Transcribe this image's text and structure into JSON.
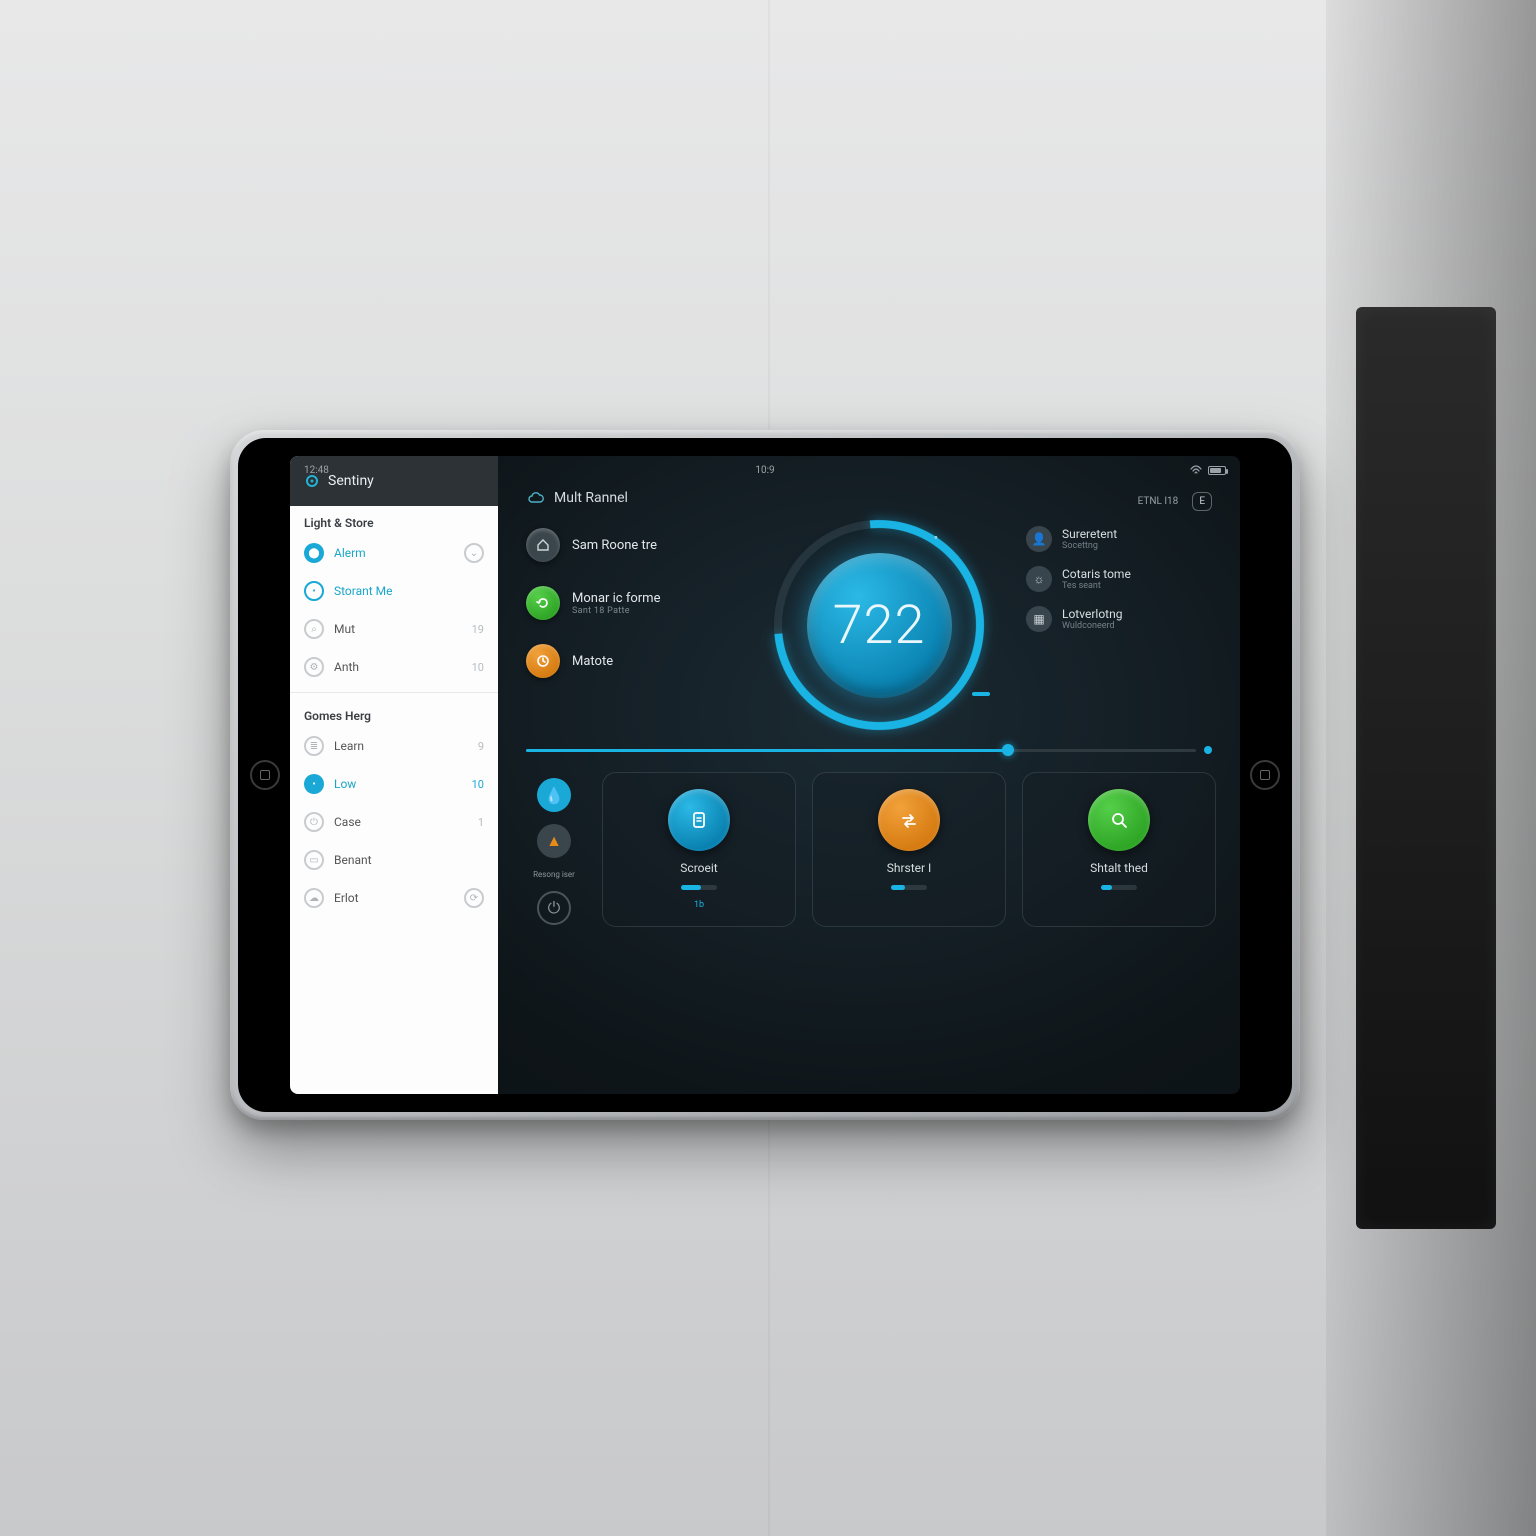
{
  "statusbar": {
    "left": "12:48",
    "center": "10:9",
    "right_label": "100%"
  },
  "sidebar": {
    "brand": "Sentiny",
    "section1": "Light & Store",
    "items_top": [
      {
        "label": "Alerm",
        "trail": ""
      },
      {
        "label": "Storant Me",
        "trail": ""
      },
      {
        "label": "Mut",
        "trail": "19"
      },
      {
        "label": "Anth",
        "trail": "10"
      }
    ],
    "section2": "Gomes Herg",
    "items_bottom": [
      {
        "label": "Learn",
        "trail": "9"
      },
      {
        "label": "Low",
        "trail": "10"
      },
      {
        "label": "Case",
        "trail": "1"
      },
      {
        "label": "Benant",
        "trail": ""
      },
      {
        "label": "Erlot",
        "trail": ""
      }
    ]
  },
  "header": {
    "title": "Mult Rannel",
    "right_text": "ETNL  I18",
    "chip": "E"
  },
  "rooms": [
    {
      "name": "Sam Roone tre",
      "sub": "",
      "color": "#3a454c",
      "glyph": "⌂"
    },
    {
      "name": "Monar ic forme",
      "sub": "Sant  18 Patte",
      "color": "#3fbf3a",
      "glyph": "↻"
    },
    {
      "name": "Matote",
      "sub": "",
      "color": "#e68a1a",
      "glyph": "◷"
    }
  ],
  "dial": {
    "value": "722",
    "unit": "°"
  },
  "quick": [
    {
      "t1": "Sureretent",
      "t2": "Socettng"
    },
    {
      "t1": "Cotaris tome",
      "t2": "Tes seant"
    },
    {
      "t1": "Lotverlotng",
      "t2": "Wuldconeerd"
    }
  ],
  "mini": {
    "label": "Resong iser"
  },
  "cards": [
    {
      "name": "Scroeit",
      "color": "blue",
      "glyph": "📄",
      "val": "1b"
    },
    {
      "name": "Shrster I",
      "color": "orange",
      "glyph": "⇄",
      "val": ""
    },
    {
      "name": "Shtalt thed",
      "color": "green",
      "glyph": "🔍",
      "val": ""
    }
  ],
  "colors": {
    "accent": "#19b4e4",
    "orange": "#e68a1a",
    "green": "#3fbf3a"
  }
}
